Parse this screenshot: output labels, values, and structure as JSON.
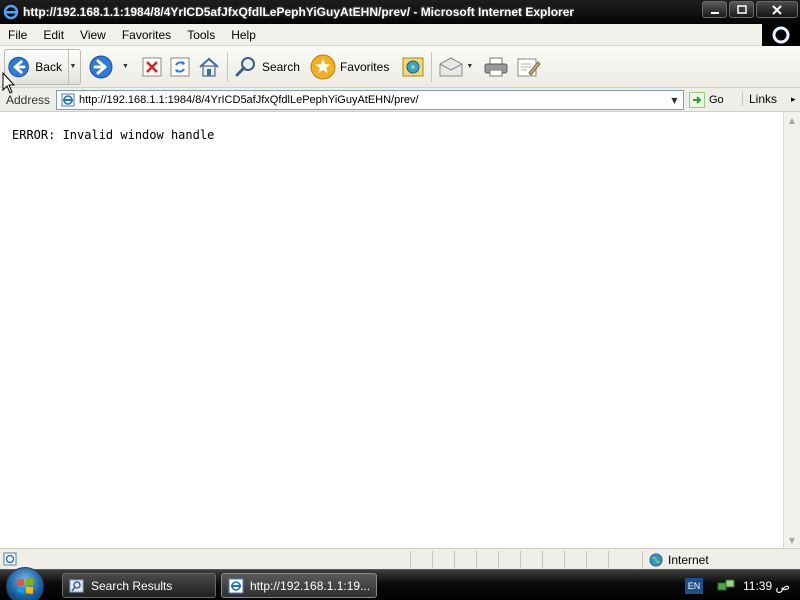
{
  "window": {
    "title": "http://192.168.1.1:1984/8/4YrICD5afJfxQfdlLePephYiGuyAtEHN/prev/ - Microsoft Internet Explorer"
  },
  "menu": {
    "items": [
      "File",
      "Edit",
      "View",
      "Favorites",
      "Tools",
      "Help"
    ]
  },
  "toolbar": {
    "back_label": "Back",
    "search_label": "Search",
    "favorites_label": "Favorites"
  },
  "address": {
    "label": "Address",
    "url": "http://192.168.1.1:1984/8/4YrICD5afJfxQfdlLePephYiGuyAtEHN/prev/",
    "go_label": "Go",
    "links_label": "Links"
  },
  "content": {
    "message": "ERROR: Invalid window handle"
  },
  "status": {
    "zone_label": "Internet"
  },
  "taskbar": {
    "tasks": [
      {
        "label": "Search Results"
      },
      {
        "label": "http://192.168.1.1:19..."
      }
    ],
    "language": "EN",
    "clock": "11:39 ص"
  },
  "colors": {
    "title_bar": "#0a0a0a",
    "chrome": "#efeee8",
    "address_border": "#7f9db9",
    "ie_blue": "#1c6fd3",
    "go_green": "#3a9a2a"
  }
}
